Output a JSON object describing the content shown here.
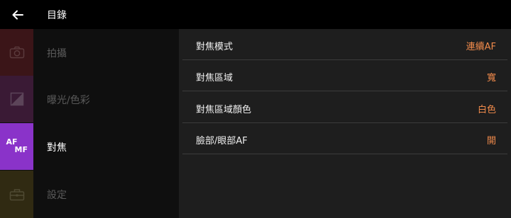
{
  "header": {
    "title": "目錄",
    "back_icon": "arrow-left-icon"
  },
  "sidebar": {
    "items": [
      {
        "label": "拍攝",
        "icon": "camera-icon"
      },
      {
        "label": "曝光/色彩",
        "icon": "exposure-icon"
      },
      {
        "label": "對焦",
        "icon_text_top": "AF",
        "icon_text_bottom": "MF",
        "active": true
      },
      {
        "label": "設定",
        "icon": "toolbox-icon"
      }
    ]
  },
  "settings": {
    "rows": [
      {
        "label": "對焦模式",
        "value": "連續AF"
      },
      {
        "label": "對焦區域",
        "value": "寬"
      },
      {
        "label": "對焦區域顏色",
        "value": "白色"
      },
      {
        "label": "臉部/眼部AF",
        "value": "開"
      }
    ]
  },
  "colors": {
    "accent_value": "#f08a4b",
    "active_category": "#8a33c9"
  }
}
